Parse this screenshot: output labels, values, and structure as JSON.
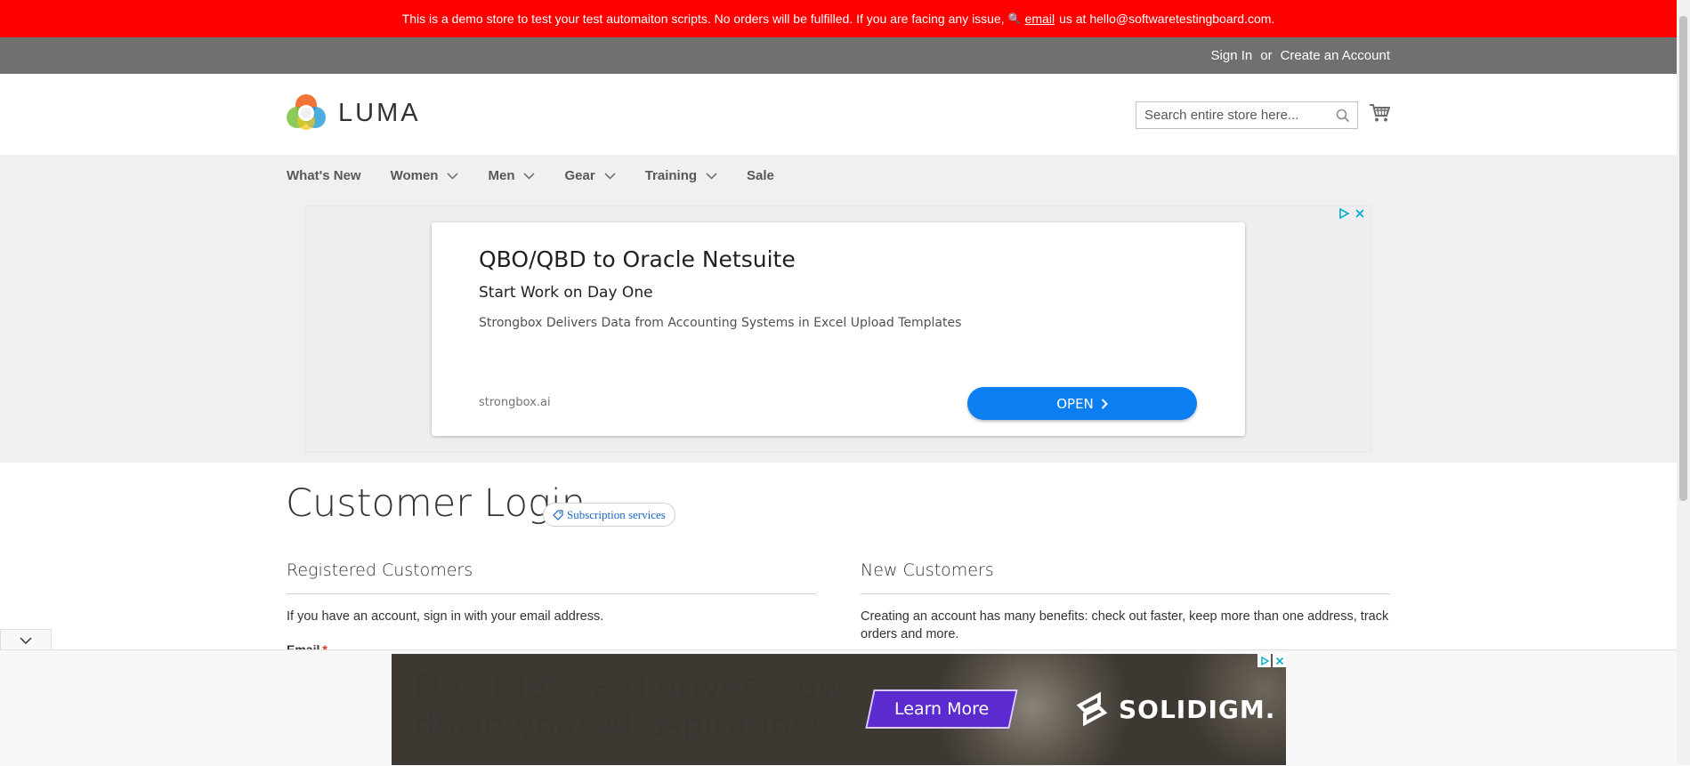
{
  "demo_notice": {
    "text": "This is a demo store to test your test automaiton scripts. No orders will be fulfilled. If you are facing any issue,",
    "email_link": "email",
    "tail": "us at hello@softwaretestingboard.com."
  },
  "panel": {
    "sign_in": "Sign In",
    "or": "or",
    "create_account": "Create an Account"
  },
  "header": {
    "logo_text": "LUMA",
    "search_placeholder": "Search entire store here..."
  },
  "nav": {
    "items": [
      {
        "label": "What's New",
        "dropdown": false
      },
      {
        "label": "Women",
        "dropdown": true
      },
      {
        "label": "Men",
        "dropdown": true
      },
      {
        "label": "Gear",
        "dropdown": true
      },
      {
        "label": "Training",
        "dropdown": true
      },
      {
        "label": "Sale",
        "dropdown": false
      }
    ]
  },
  "ad": {
    "title": "QBO/QBD to Oracle Netsuite",
    "subtitle": "Start Work on Day One",
    "description": "Strongbox Delivers Data from Accounting Systems in Excel Upload Templates",
    "domain": "strongbox.ai",
    "cta": "OPEN"
  },
  "page": {
    "title": "Customer Login",
    "subscription_badge": "Subscription services"
  },
  "registered": {
    "title": "Registered Customers",
    "text": "If you have an account, sign in with your email address.",
    "email_label": "Email",
    "required_mark": "*"
  },
  "new_customers": {
    "title": "New Customers",
    "text": "Creating an account has many benefits: check out faster, keep more than one address, track orders and more."
  },
  "banner": {
    "text_line1": "Don’t let hard drives slow",
    "text_line2": "down your AI aspirations.",
    "cta": "Learn More",
    "brand": "SOLIDIGM."
  },
  "colors": {
    "demo_bar": "#ff0000",
    "panel_bar": "#6e716e",
    "nav_bg": "#f0f0f0",
    "ad_button": "#0b7ef2",
    "banner_button": "#5b2bd0",
    "required": "#e02b27"
  }
}
